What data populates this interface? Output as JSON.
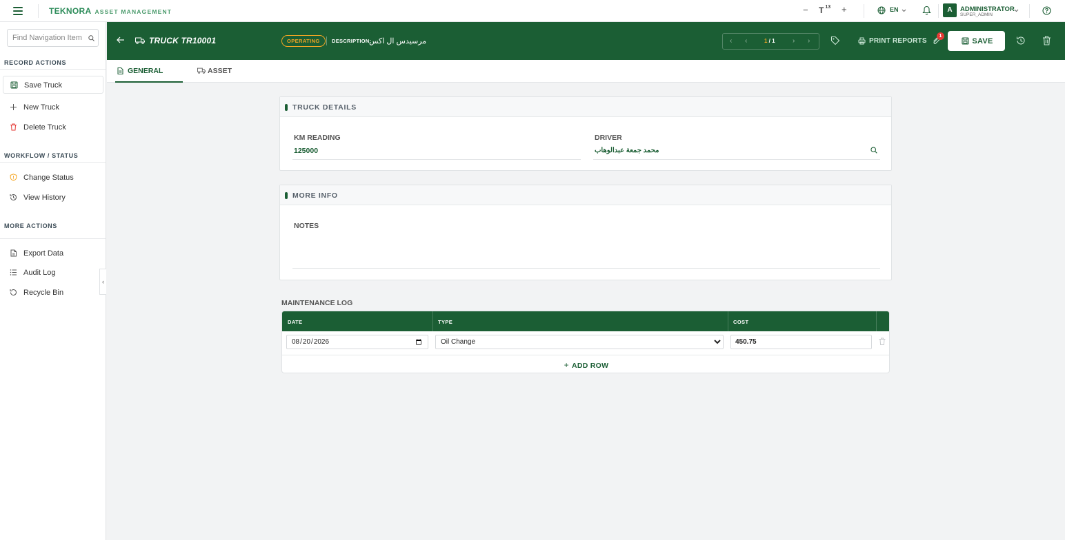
{
  "topbar": {
    "logo": "TEKNORA",
    "logo_sub": "ASSET MANAGEMENT",
    "font_minus": "−",
    "font_size": "13",
    "font_plus": "+",
    "language": "EN",
    "user_initial": "A",
    "user_name": "ADMINISTRATOR",
    "user_role": "SUPER_ADMIN"
  },
  "sidebar": {
    "search_placeholder": "Find Navigation Item",
    "sections": [
      {
        "title": "RECORD ACTIONS",
        "items": [
          "Save Truck",
          "New Truck",
          "Delete Truck"
        ]
      },
      {
        "title": "WORKFLOW / STATUS",
        "items": [
          "Change Status",
          "View History"
        ]
      },
      {
        "title": "MORE ACTIONS",
        "items": [
          "Export Data",
          "Audit Log",
          "Recycle Bin"
        ]
      }
    ]
  },
  "header": {
    "title": "TRUCK TR10001",
    "status": "OPERATING",
    "description_label": "DESCRIPTION:",
    "description_value": "مرسيدس ال اكس",
    "pager_current": "1",
    "pager_total": "1",
    "print_label": "PRINT REPORTS",
    "attachments_count": "1",
    "save_label": "SAVE"
  },
  "tabs": [
    {
      "label": "GENERAL"
    },
    {
      "label": "ASSET"
    }
  ],
  "truck_details": {
    "title": "TRUCK DETAILS",
    "km_label": "KM READING",
    "km_value": "125000",
    "driver_label": "DRIVER",
    "driver_value": "محمد جمعة عبدالوهاب"
  },
  "more_info": {
    "title": "MORE INFO",
    "notes_label": "NOTES"
  },
  "maintenance": {
    "title": "MAINTENANCE LOG",
    "columns": [
      "DATE",
      "TYPE",
      "COST"
    ],
    "rows": [
      {
        "date": "2026-08-20",
        "type": "Oil Change",
        "cost": "450.75"
      }
    ],
    "add_row_label": "ADD ROW"
  },
  "colors": {
    "brand": "#1b5e34",
    "status": "#f5a623",
    "danger": "#e53935"
  }
}
